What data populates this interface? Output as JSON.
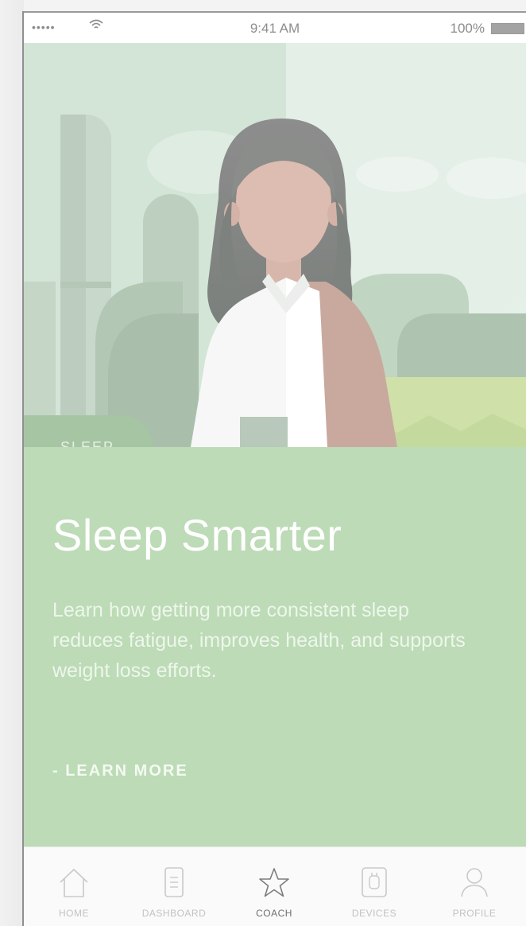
{
  "status_bar": {
    "signal": "•••••",
    "wifi_icon": "wifi-icon",
    "time": "9:41 AM",
    "battery_text": "100%",
    "battery_icon": "battery-icon"
  },
  "hero": {
    "illustration": "woman-portrait-illustration"
  },
  "card": {
    "category": "SLEEP",
    "title": "Sleep Smarter",
    "body": "Learn how getting more consistent sleep reduces fatigue, improves health, and supports weight loss efforts.",
    "cta": "- LEARN MORE",
    "background_color": "#bcdbb6"
  },
  "tabs": [
    {
      "label": "HOME",
      "icon": "home-icon",
      "active": false
    },
    {
      "label": "DASHBOARD",
      "icon": "dashboard-icon",
      "active": false
    },
    {
      "label": "COACH",
      "icon": "star-icon",
      "active": true
    },
    {
      "label": "DEVICES",
      "icon": "watch-icon",
      "active": false
    },
    {
      "label": "PROFILE",
      "icon": "profile-icon",
      "active": false
    }
  ]
}
